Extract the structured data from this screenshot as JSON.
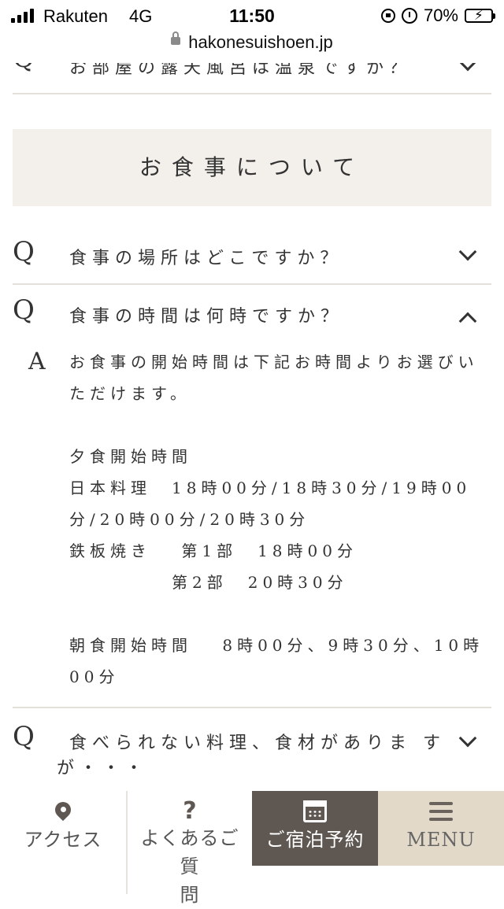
{
  "status_bar": {
    "carrier": "Rakuten",
    "network": "4G",
    "time": "11:50",
    "battery": "70%",
    "battery_level": 0.7,
    "icons": [
      "signal-icon",
      "orientation-lock-icon",
      "alarm-icon",
      "battery-charging-icon"
    ]
  },
  "browser": {
    "url": "hakonesuishoen.jp",
    "icon": "padlock-icon"
  },
  "faq": {
    "top_partial_question": "お部屋の露天風呂は温泉ですか？",
    "section_title": "お食事について",
    "q_marker": "Q",
    "a_marker": "A",
    "items": [
      {
        "question": "食事の場所はどこですか？",
        "expanded": false
      },
      {
        "question": "食事の時間は何時ですか？",
        "expanded": true,
        "answer_lines": [
          "お食事の開始時間は下記お時間よりお選びい",
          "ただけます。",
          "夕食開始時間",
          "日本料理　18時00分/18時30分/19時00",
          "分/20時00分/20時30分",
          "鉄板焼き　 第1部　18時00分",
          "第2部　20時30分",
          "朝食開始時間　 8時00分、9時30分、10時",
          "00分"
        ]
      },
      {
        "question_line1": "食べられない料理、食材がありま す",
        "question_line2": "が・・・",
        "expanded": false
      }
    ]
  },
  "bottom_nav": {
    "access": "アクセス",
    "faq_line1": "よくあるご質",
    "faq_line2": "問",
    "reserve": "ご宿泊予約",
    "menu": "MENU"
  },
  "colors": {
    "section_bg": "#f3f0eb",
    "reserve_bg": "#5f5752",
    "menu_bg": "#e2d9c9",
    "divider": "#e3e0db",
    "text": "#333333"
  }
}
